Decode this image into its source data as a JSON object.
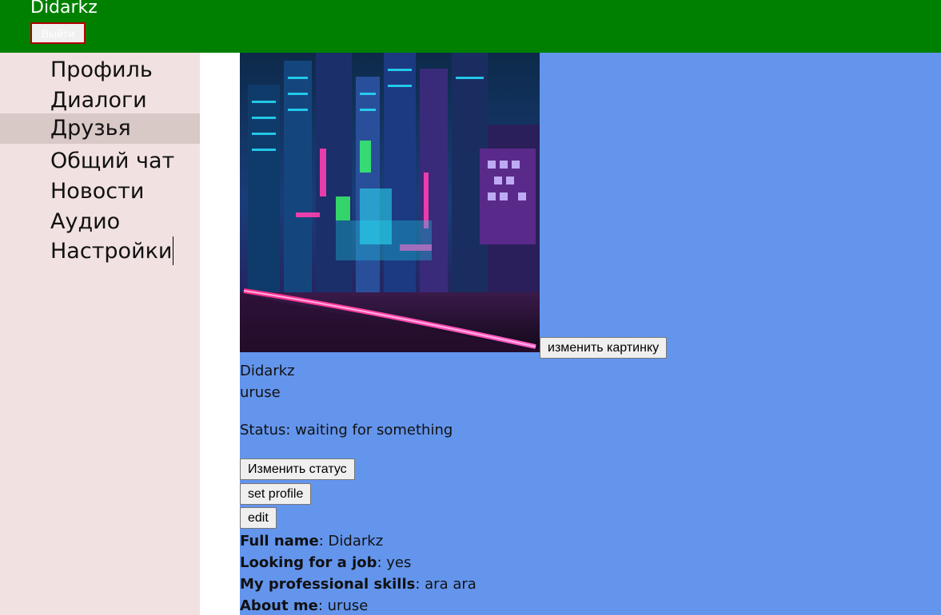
{
  "header": {
    "user_name": "Didarkz",
    "logout_label": "Выйти"
  },
  "sidebar": {
    "items": [
      {
        "label": "Профиль"
      },
      {
        "label": "Диалоги"
      },
      {
        "label": "Друзья",
        "active": true
      },
      {
        "label": "Общий чат"
      },
      {
        "label": "Новости"
      },
      {
        "label": "Аудио"
      },
      {
        "label": "Настройки"
      }
    ]
  },
  "profile": {
    "change_picture_label": "изменить картинку",
    "name": "Didarkz",
    "subtitle": "uruse",
    "status_prefix": "Status: ",
    "status": "waiting for something",
    "change_status_label": "Изменить статус",
    "set_profile_label": "set profile",
    "edit_label": "edit",
    "fields": [
      {
        "label": "Full name",
        "value": "Didarkz"
      },
      {
        "label": "Looking for a job",
        "value": "yes"
      },
      {
        "label": "My professional skills",
        "value": "ara ara"
      },
      {
        "label": "About me",
        "value": "uruse"
      }
    ]
  },
  "colors": {
    "header_bg": "#008000",
    "sidebar_bg": "#f1e2e1",
    "sidebar_active_bg": "#d8c8c6",
    "content_bg": "#6495ed",
    "logout_border": "#b00000"
  }
}
